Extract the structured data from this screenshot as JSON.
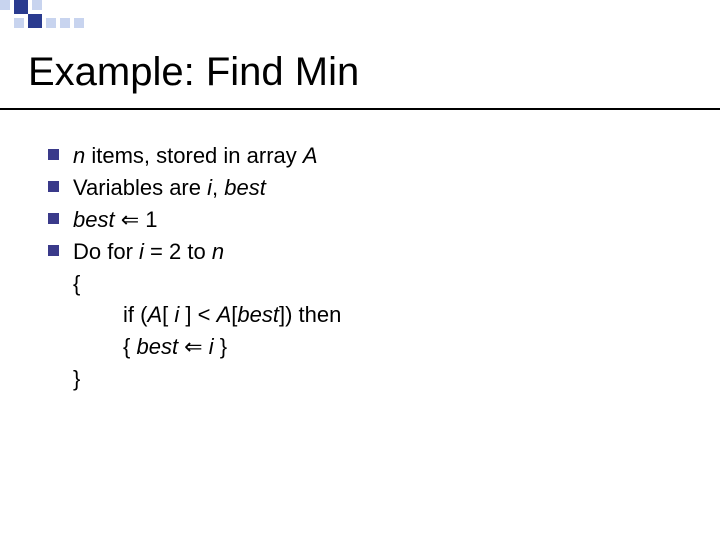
{
  "title": "Example: Find Min",
  "lines": {
    "l1a": "n",
    "l1b": " items, stored in array ",
    "l1c": "A",
    "l2a": "Variables are ",
    "l2b": "i",
    "l2c": ", ",
    "l2d": "best",
    "l3a": "best",
    "l3b": " ⇐ 1",
    "l4a": "Do for ",
    "l4b": "i",
    "l4c": " = 2 to ",
    "l4d": "n",
    "l5": "{",
    "l6a": "if (",
    "l6b": "A",
    "l6c": "[ ",
    "l6d": "i",
    "l6e": " ] < ",
    "l6f": "A",
    "l6g": "[",
    "l6h": "best",
    "l6i": "]) then",
    "l7a": "{ ",
    "l7b": "best",
    "l7c": " ⇐ ",
    "l7d": "i",
    "l7e": " }",
    "l8": "}"
  }
}
